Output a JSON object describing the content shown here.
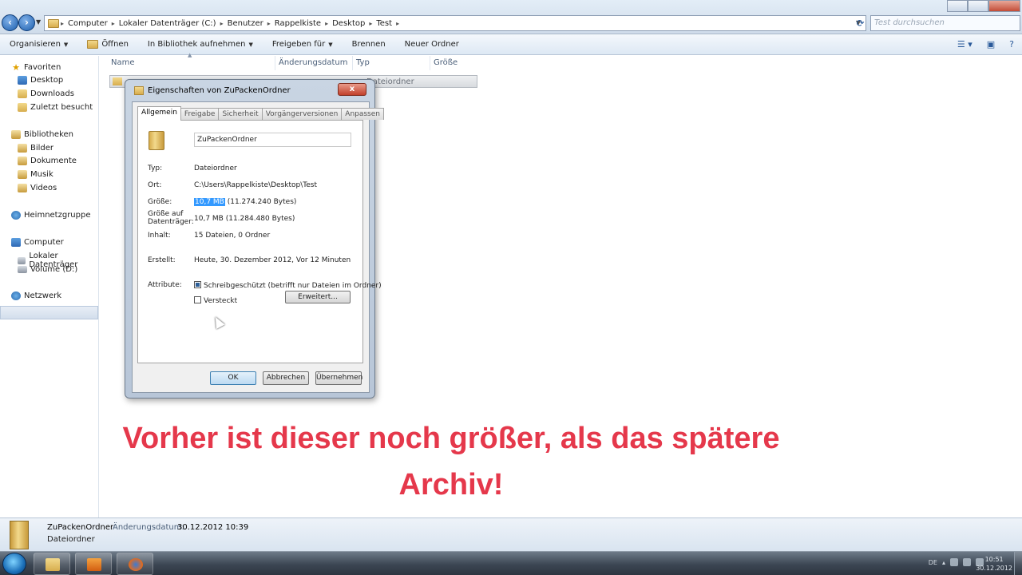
{
  "window": {
    "breadcrumb": [
      "Computer",
      "Lokaler Datenträger (C:)",
      "Benutzer",
      "Rappelkiste",
      "Desktop",
      "Test"
    ],
    "search_placeholder": "Test durchsuchen"
  },
  "toolbar": {
    "organize": "Organisieren",
    "open": "Öffnen",
    "include_library": "In Bibliothek aufnehmen",
    "share": "Freigeben für",
    "burn": "Brennen",
    "new_folder": "Neuer Ordner"
  },
  "nav": {
    "favorites": "Favoriten",
    "desktop": "Desktop",
    "downloads": "Downloads",
    "recent": "Zuletzt besucht",
    "libraries": "Bibliotheken",
    "pictures": "Bilder",
    "documents": "Dokumente",
    "music": "Musik",
    "videos": "Videos",
    "homegroup": "Heimnetzgruppe",
    "computer": "Computer",
    "local_disk": "Lokaler Datenträger",
    "volume_d": "Volume (D:)",
    "network": "Netzwerk"
  },
  "columns": {
    "name": "Name",
    "modified": "Änderungsdatum",
    "type": "Typ",
    "size": "Größe"
  },
  "file_row": {
    "name": "ZuPackenOrdner",
    "type": "Dateiordner"
  },
  "dialog": {
    "title": "Eigenschaften von ZuPackenOrdner",
    "close": "x",
    "tabs": [
      "Allgemein",
      "Freigabe",
      "Sicherheit",
      "Vorgängerversionen",
      "Anpassen"
    ],
    "folder_name": "ZuPackenOrdner",
    "labels": {
      "type": "Typ:",
      "location": "Ort:",
      "size": "Größe:",
      "size_on_disk_1": "Größe auf",
      "size_on_disk_2": "Datenträger:",
      "contents": "Inhalt:",
      "created": "Erstellt:",
      "attributes": "Attribute:"
    },
    "values": {
      "type": "Dateiordner",
      "location": "C:\\Users\\Rappelkiste\\Desktop\\Test",
      "size_hl": "10,7 MB",
      "size_rest": "(11.274.240 Bytes)",
      "size_on_disk": "10,7 MB (11.284.480 Bytes)",
      "contents": "15 Dateien, 0 Ordner",
      "created": "Heute, 30. Dezember 2012, Vor 12 Minuten"
    },
    "readonly": "Schreibgeschützt (betrifft nur Dateien im Ordner)",
    "hidden": "Versteckt",
    "advanced": "Erweitert...",
    "ok": "OK",
    "cancel": "Abbrechen",
    "apply": "Übernehmen"
  },
  "caption": {
    "line1": "Vorher ist dieser noch größer, als das spätere",
    "line2": "Archiv!"
  },
  "details": {
    "name": "ZuPackenOrdner",
    "modified_label": "Änderungsdatum:",
    "modified_value": "30.12.2012 10:39",
    "type": "Dateiordner"
  },
  "taskbar": {
    "lang": "DE",
    "time": "10:51",
    "date": "30.12.2012"
  },
  "colors": {
    "caption": "#e5384b",
    "highlight": "#3399ff"
  }
}
